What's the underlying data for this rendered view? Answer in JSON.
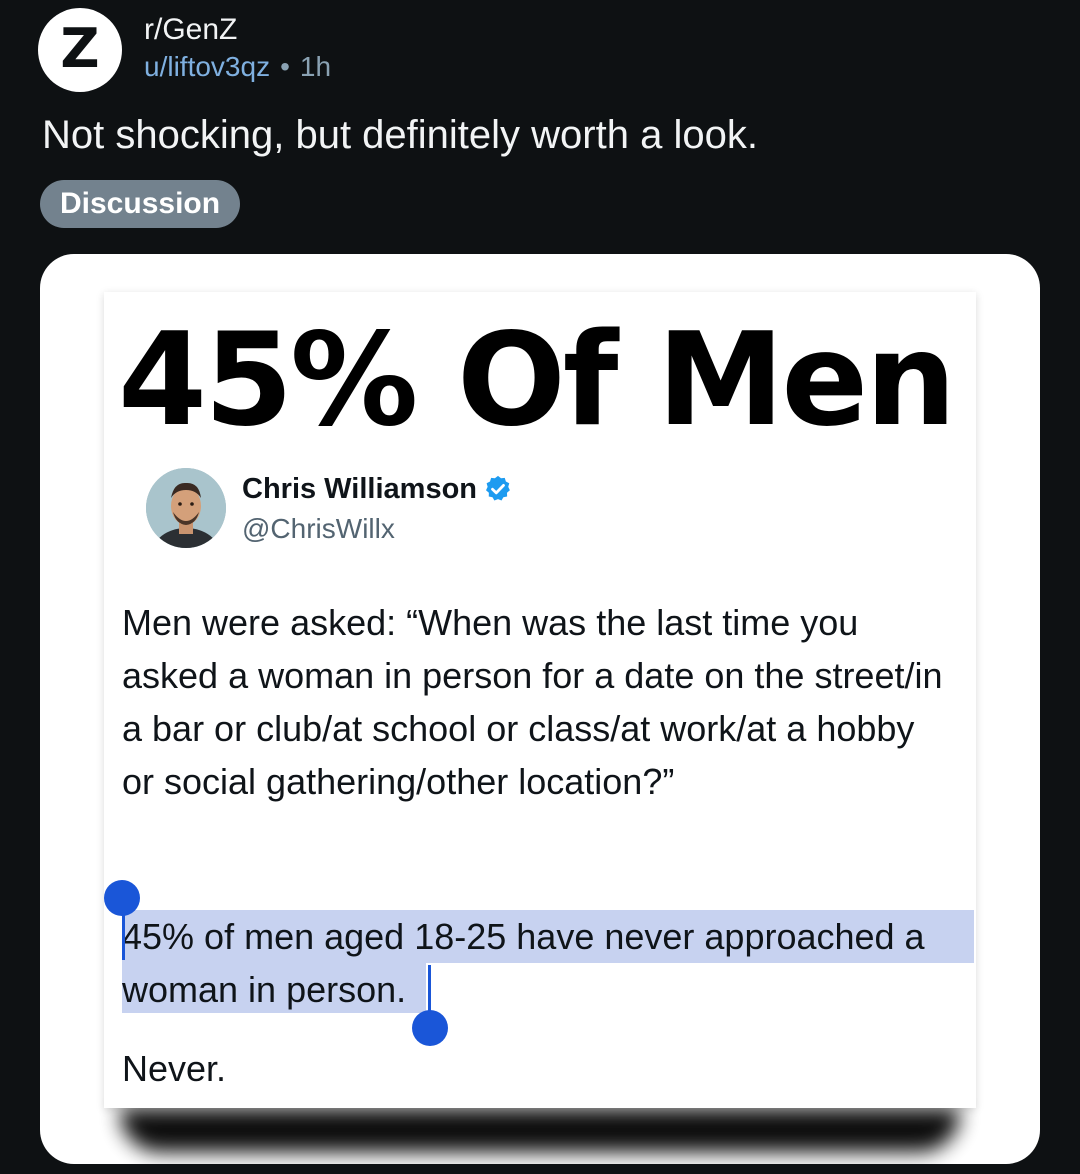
{
  "post": {
    "subreddit_icon_letter": "Z",
    "subreddit": "r/GenZ",
    "author": "u/liftov3qz",
    "separator": "•",
    "age": "1h",
    "title": "Not shocking, but definitely worth a look.",
    "flair": "Discussion"
  },
  "image": {
    "headline": "45% Of Men",
    "tweet": {
      "name": "Chris Williamson",
      "handle": "@ChrisWillx",
      "verified": true,
      "body": "Men were asked: “When was the last time you asked a woman in person for a date on the street/in a bar or club/at school or class/at work/at a hobby or social gathering/other location?”",
      "highlighted": "45% of men aged 18-25 have never approached a woman in person.",
      "closing": "Never."
    }
  },
  "colors": {
    "background": "#0e1113",
    "flair_bg": "#73828e",
    "verified_blue": "#1d9bf0",
    "selection_handle": "#1a56d8",
    "selection_highlight": "#c7d2f0"
  }
}
